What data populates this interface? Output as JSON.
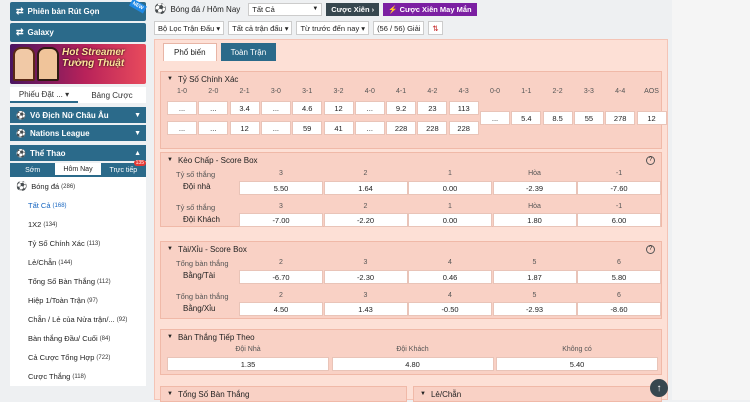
{
  "left": {
    "top_buttons": [
      "Phiên bản Rút Gọn",
      "Galaxy"
    ],
    "new_tag": "NEW",
    "banner_text": [
      "Hot Streamer",
      "Tường Thuật"
    ],
    "bet_tabs": [
      "Phiếu Đặt ...",
      "Bảng Cược"
    ],
    "leagues": [
      "Vô Địch Nữ Châu Âu",
      "Nations League"
    ],
    "sport_section": "Thể Thao",
    "time_tabs": [
      "Sớm",
      "Hôm Nay",
      "Trực tiếp"
    ],
    "live_count": "135",
    "sport": "Bóng đá",
    "sport_count": "(286)",
    "menu": [
      {
        "label": "Tất Cả",
        "count": "(168)"
      },
      {
        "label": "1X2",
        "count": "(134)"
      },
      {
        "label": "Tỷ Số Chính Xác",
        "count": "(113)"
      },
      {
        "label": "Lẻ/Chẵn",
        "count": "(144)"
      },
      {
        "label": "Tổng Số Bàn Thắng",
        "count": "(112)"
      },
      {
        "label": "Hiệp 1/Toàn Trận",
        "count": "(97)"
      },
      {
        "label": "Chẵn / Lẻ của Nửa trận/...",
        "count": "(92)"
      },
      {
        "label": "Bàn thắng Đầu/ Cuối",
        "count": "(84)"
      },
      {
        "label": "Cả Cược Tổng Hợp",
        "count": "(722)"
      },
      {
        "label": "Cược Thắng",
        "count": "(118)"
      }
    ]
  },
  "top": {
    "breadcrumb": "Bóng đá / Hôm Nay",
    "select": "Tất Cả",
    "cuoc_xien": "Cược Xiên",
    "cuoc_xien_may_man": "Cược Xiên May Mắn",
    "filters": [
      "Bộ Lọc Trận Đấu",
      "Tất cả trận đấu",
      "Từ trước đến nay",
      "(56 / 56) Giải"
    ]
  },
  "panel": {
    "tabs": [
      "Phổ biến",
      "Toàn Trận"
    ],
    "exact": {
      "title": "Tỷ Số Chính Xác",
      "cols": [
        "1-0",
        "2-0",
        "2-1",
        "3-0",
        "3-1",
        "3-2",
        "4-0",
        "4-1",
        "4-2",
        "4-3",
        "0-0",
        "1-1",
        "2-2",
        "3-3",
        "4-4",
        "AOS"
      ],
      "row1": [
        "...",
        "...",
        "3.4",
        "...",
        "4.6",
        "12",
        "...",
        "9.2",
        "23",
        "113"
      ],
      "row2": [
        "...",
        "...",
        "12",
        "...",
        "59",
        "41",
        "...",
        "228",
        "228",
        "228"
      ],
      "mid": [
        "...",
        "5.4",
        "8.5",
        "55",
        "278",
        "12"
      ]
    },
    "handicap": {
      "title": "Kèo Chấp - Score Box",
      "help": "?",
      "label1": "Tỷ số thắng",
      "heads": [
        "3",
        "2",
        "1",
        "Hòa",
        "-1"
      ],
      "home": "Đội nhà",
      "home_vals": [
        "5.50",
        "1.64",
        "0.00",
        "-2.39",
        "-7.60"
      ],
      "label2": "Tỷ số thắng",
      "away": "Đội Khách",
      "away_vals": [
        "-7.00",
        "-2.20",
        "0.00",
        "1.80",
        "6.00"
      ]
    },
    "ou": {
      "title": "Tài/Xỉu - Score Box",
      "help": "?",
      "label1": "Tổng bàn thắng",
      "heads": [
        "2",
        "3",
        "4",
        "5",
        "6"
      ],
      "row1": "Bằng/Tài",
      "row1_vals": [
        "-6.70",
        "-2.30",
        "0.46",
        "1.87",
        "5.80"
      ],
      "label2": "Tổng bàn thắng",
      "row2": "Bằng/Xỉu",
      "row2_vals": [
        "4.50",
        "1.43",
        "-0.50",
        "-2.93",
        "-8.60"
      ]
    },
    "next": {
      "title": "Bàn Thắng Tiếp Theo",
      "heads": [
        "Đội Nhà",
        "Đội Khách",
        "Không có"
      ],
      "vals": [
        "1.35",
        "4.80",
        "5.40"
      ]
    },
    "bottom_titles": [
      "Tổng Số Bàn Thắng",
      "Lẻ/Chẵn"
    ]
  }
}
